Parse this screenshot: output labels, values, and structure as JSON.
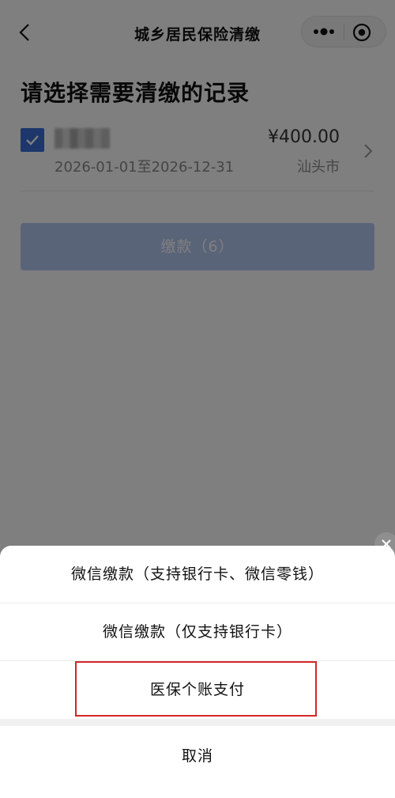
{
  "navbar": {
    "title": "城乡居民保险清缴"
  },
  "page": {
    "heading": "请选择需要清缴的记录"
  },
  "record": {
    "checked": true,
    "name_redacted": true,
    "date_range": "2026-01-01至2026-12-31",
    "amount": "¥400.00",
    "city": "汕头市"
  },
  "pay_button": {
    "label": "缴款（6）"
  },
  "action_sheet": {
    "options": [
      {
        "label": "微信缴款（支持银行卡、微信零钱）"
      },
      {
        "label": "微信缴款（仅支持银行卡）"
      },
      {
        "label": "医保个账支付"
      }
    ],
    "cancel_label": "取消"
  },
  "colors": {
    "accent": "#3b6fd6",
    "button_disabled": "#b5c9f3",
    "highlight": "#d42626"
  },
  "icons": [
    "chevron-left-icon",
    "more-icon",
    "target-icon",
    "checkmark-icon",
    "chevron-right-icon",
    "close-icon"
  ]
}
